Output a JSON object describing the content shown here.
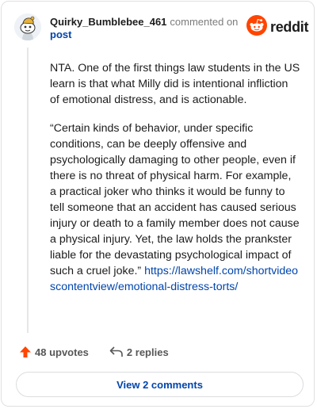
{
  "comment": {
    "username": "Quirky_Bumblebee_461",
    "action_text": "commented on",
    "post_link": "post",
    "paragraph1": "NTA. One of the first things law students in the US learn is that what Milly did is intentional infliction of emotional distress, and is actionable.",
    "paragraph2": "“Certain kinds of behavior, under specific conditions, can be deeply offensive and psychologically damaging to other people, even if there is no threat of physical harm. For example, a practical joker who thinks it would be funny to tell someone that an accident has caused serious injury or death to a family member does not cause a physical injury. Yet, the law holds the prankster liable for the devastating psychological impact of such a cruel joke.”",
    "link_url": "https://lawshelf.com/shortvideoscontentview/emotional-distress-torts/"
  },
  "brand": {
    "wordmark": "reddit",
    "color": "#ff4500"
  },
  "footer": {
    "upvotes": "48 upvotes",
    "replies": "2 replies",
    "view_comments": "View 2 comments"
  },
  "icons": {
    "avatar": "snoo-avatar-icon",
    "logo": "reddit-logo-icon",
    "upvote": "upvote-arrow-icon",
    "reply": "reply-arrow-icon"
  }
}
